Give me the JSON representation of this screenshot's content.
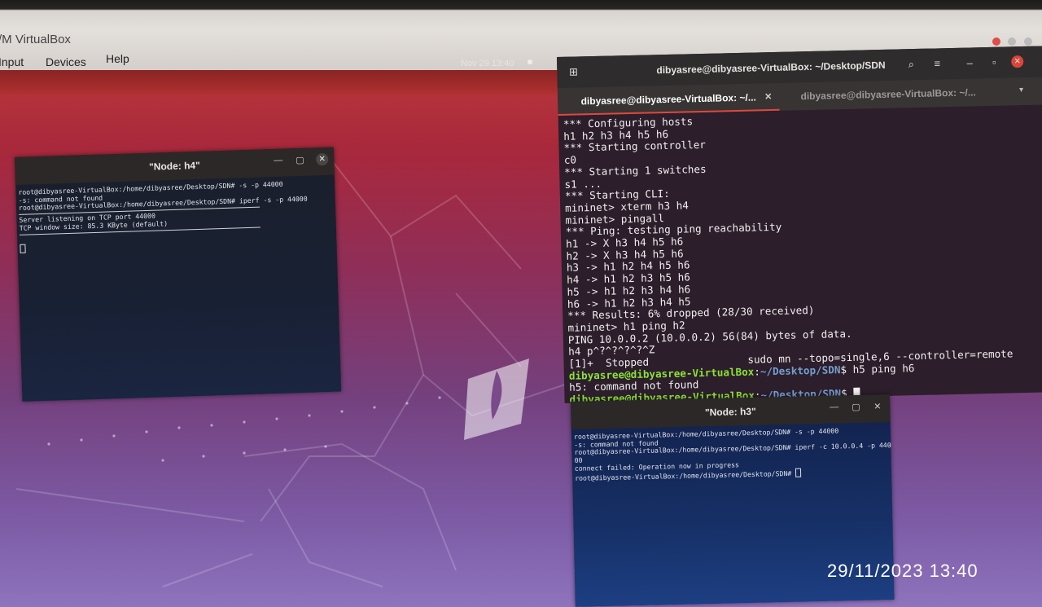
{
  "virtualbox": {
    "title": "/M VirtualBox",
    "menu": [
      "Input",
      "Devices",
      "Help"
    ]
  },
  "gnome": {
    "clock": "Nov 29  13:40"
  },
  "terminal": {
    "title": "dibyasree@dibyasree-VirtualBox: ~/Desktop/SDN",
    "tabs": [
      {
        "label": "dibyasree@dibyasree-VirtualBox: ~/...",
        "active": true
      },
      {
        "label": "dibyasree@dibyasree-VirtualBox: ~/...",
        "active": false
      }
    ],
    "lines": [
      "*** Configuring hosts",
      "h1 h2 h3 h4 h5 h6",
      "*** Starting controller",
      "c0",
      "*** Starting 1 switches",
      "s1 ...",
      "*** Starting CLI:",
      "mininet> xterm h3 h4",
      "mininet> pingall",
      "*** Ping: testing ping reachability",
      "h1 -> X h3 h4 h5 h6",
      "h2 -> X h3 h4 h5 h6",
      "h3 -> h1 h2 h4 h5 h6",
      "h4 -> h1 h2 h3 h5 h6",
      "h5 -> h1 h2 h3 h4 h6",
      "h6 -> h1 h2 h3 h4 h5",
      "*** Results: 6% dropped (28/30 received)",
      "mininet> h1 ping h2",
      "PING 10.0.0.2 (10.0.0.2) 56(84) bytes of data.",
      "h4 p^?^?^?^?^Z"
    ],
    "stopped": "[1]+  Stopped",
    "stopped_cmd": "sudo mn --topo=single,6 --controller=remote",
    "prompt_user": "dibyasree@dibyasree-VirtualBox",
    "prompt_path": "~/Desktop/SDN",
    "prompt_cmd": "h5 ping h6",
    "error_line": "h5: command not found"
  },
  "xterm_h4": {
    "title": "\"Node: h4\"",
    "lines": [
      "root@dibyasree-VirtualBox:/home/dibyasree/Desktop/SDN# -s -p 44000",
      "-s: command not found",
      "root@dibyasree-VirtualBox:/home/dibyasree/Desktop/SDN# iperf -s -p 44000"
    ],
    "server_lines": [
      "Server listening on TCP port 44000",
      "TCP window size: 85.3 KByte (default)"
    ]
  },
  "xterm_h3": {
    "title": "\"Node: h3\"",
    "lines": [
      "root@dibyasree-VirtualBox:/home/dibyasree/Desktop/SDN# -s -p 44000",
      "-s: command not found",
      "root@dibyasree-VirtualBox:/home/dibyasree/Desktop/SDN# iperf -c 10.0.0.4 -p 440",
      "00",
      "connect failed: Operation now in progress",
      "root@dibyasree-VirtualBox:/home/dibyasree/Desktop/SDN# "
    ]
  },
  "photo_timestamp": "29/11/2023  13:40"
}
